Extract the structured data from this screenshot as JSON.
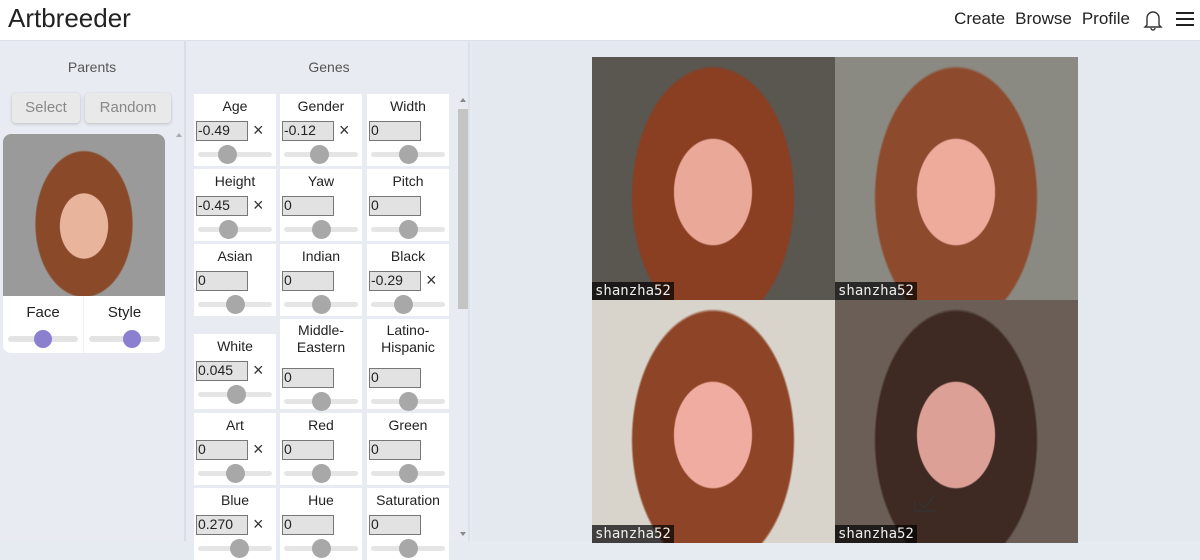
{
  "header": {
    "logo": "Artbreeder",
    "nav": [
      "Create",
      "Browse",
      "Profile"
    ],
    "icons": [
      "bell-icon",
      "menu-icon"
    ]
  },
  "parents": {
    "title": "Parents",
    "select_label": "Select",
    "random_label": "Random",
    "face_label": "Face",
    "style_label": "Style",
    "face_value": 0.5,
    "style_value": 0.6,
    "accent": "#8b7fd0"
  },
  "genes": {
    "title": "Genes",
    "items": [
      {
        "label": "Age",
        "value": "-0.49",
        "clear": true
      },
      {
        "label": "Gender",
        "value": "-0.12",
        "clear": true
      },
      {
        "label": "Width",
        "value": "0",
        "clear": false
      },
      {
        "label": "Height",
        "value": "-0.45",
        "clear": true
      },
      {
        "label": "Yaw",
        "value": "0",
        "clear": false
      },
      {
        "label": "Pitch",
        "value": "0",
        "clear": false
      },
      {
        "label": "Asian",
        "value": "0",
        "clear": false
      },
      {
        "label": "Indian",
        "value": "0",
        "clear": false
      },
      {
        "label": "Black",
        "value": "-0.29",
        "clear": true
      },
      {
        "label": "White",
        "value": "0.045",
        "clear": true
      },
      {
        "label": "Middle-\nEastern",
        "value": "0",
        "clear": false
      },
      {
        "label": "Latino-\nHispanic",
        "value": "0",
        "clear": false
      },
      {
        "label": "Art",
        "value": "0",
        "clear": true
      },
      {
        "label": "Red",
        "value": "0",
        "clear": false
      },
      {
        "label": "Green",
        "value": "0",
        "clear": false
      },
      {
        "label": "Blue",
        "value": "0.270",
        "clear": true
      },
      {
        "label": "Hue",
        "value": "0",
        "clear": false
      },
      {
        "label": "Saturation",
        "value": "0",
        "clear": false
      }
    ]
  },
  "results": [
    {
      "author": "shanzha52"
    },
    {
      "author": "shanzha52"
    },
    {
      "author": "shanzha52"
    },
    {
      "author": "shanzha52",
      "selected": true
    }
  ]
}
